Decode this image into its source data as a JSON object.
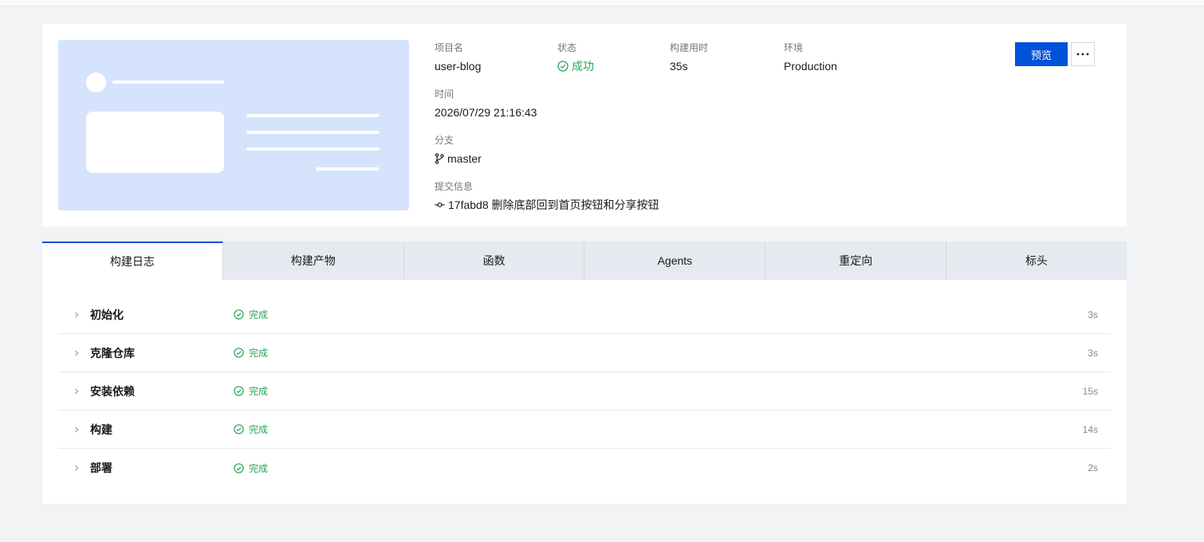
{
  "project": {
    "name_label": "项目名",
    "name": "user-blog",
    "status_label": "状态",
    "status": "成功",
    "duration_label": "构建用时",
    "duration": "35s",
    "env_label": "环境",
    "env": "Production",
    "time_label": "时间",
    "time": "2026/07/29 21:16:43",
    "branch_label": "分支",
    "branch": "master",
    "commit_label": "提交信息",
    "commit": "17fabd8 删除底部回到首页按钮和分享按钮"
  },
  "actions": {
    "preview_label": "预览",
    "more_label": "···"
  },
  "tabs": [
    {
      "label": "构建日志",
      "active": true
    },
    {
      "label": "构建产物",
      "active": false
    },
    {
      "label": "函数",
      "active": false
    },
    {
      "label": "Agents",
      "active": false
    },
    {
      "label": "重定向",
      "active": false
    },
    {
      "label": "标头",
      "active": false
    }
  ],
  "steps": [
    {
      "name": "初始化",
      "status": "完成",
      "time": "3s"
    },
    {
      "name": "克隆仓库",
      "status": "完成",
      "time": "3s"
    },
    {
      "name": "安装依赖",
      "status": "完成",
      "time": "15s"
    },
    {
      "name": "构建",
      "status": "完成",
      "time": "14s"
    },
    {
      "name": "部署",
      "status": "完成",
      "time": "2s"
    }
  ],
  "colors": {
    "accent": "#0052d9",
    "success": "#27a55a",
    "thumb_bg": "#d6e3fc"
  },
  "icons": {
    "status": "check-circle-icon",
    "branch": "git-branch-icon",
    "commit": "git-commit-icon",
    "expand": "chevron-right-icon",
    "more": "more-horizontal-icon"
  }
}
